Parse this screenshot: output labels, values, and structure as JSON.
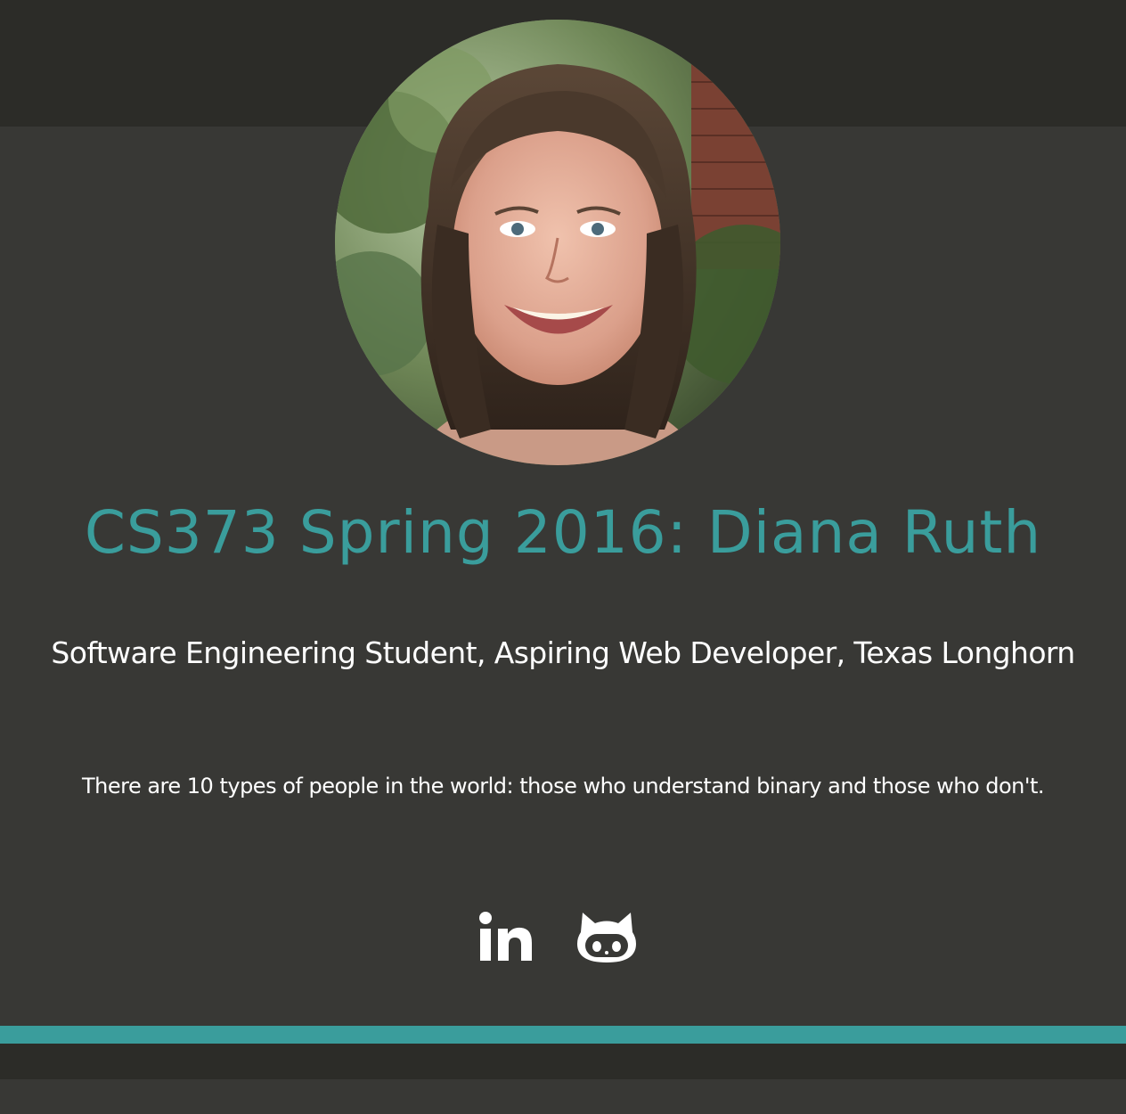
{
  "profile": {
    "photo_alt": "Profile photo of Diana Ruth",
    "title": "CS373 Spring 2016: Diana Ruth",
    "subtitle": "Software Engineering Student, Aspiring Web Developer, Texas Longhorn",
    "quote": "There are 10 types of people in the world: those who understand binary and those who don't."
  },
  "social": [
    {
      "name": "LinkedIn",
      "icon": "linkedin-icon"
    },
    {
      "name": "GitHub",
      "icon": "github-icon"
    }
  ],
  "colors": {
    "accent": "#3a9d9c",
    "background": "#383835",
    "band": "#2c2c28",
    "text": "#ffffff"
  }
}
